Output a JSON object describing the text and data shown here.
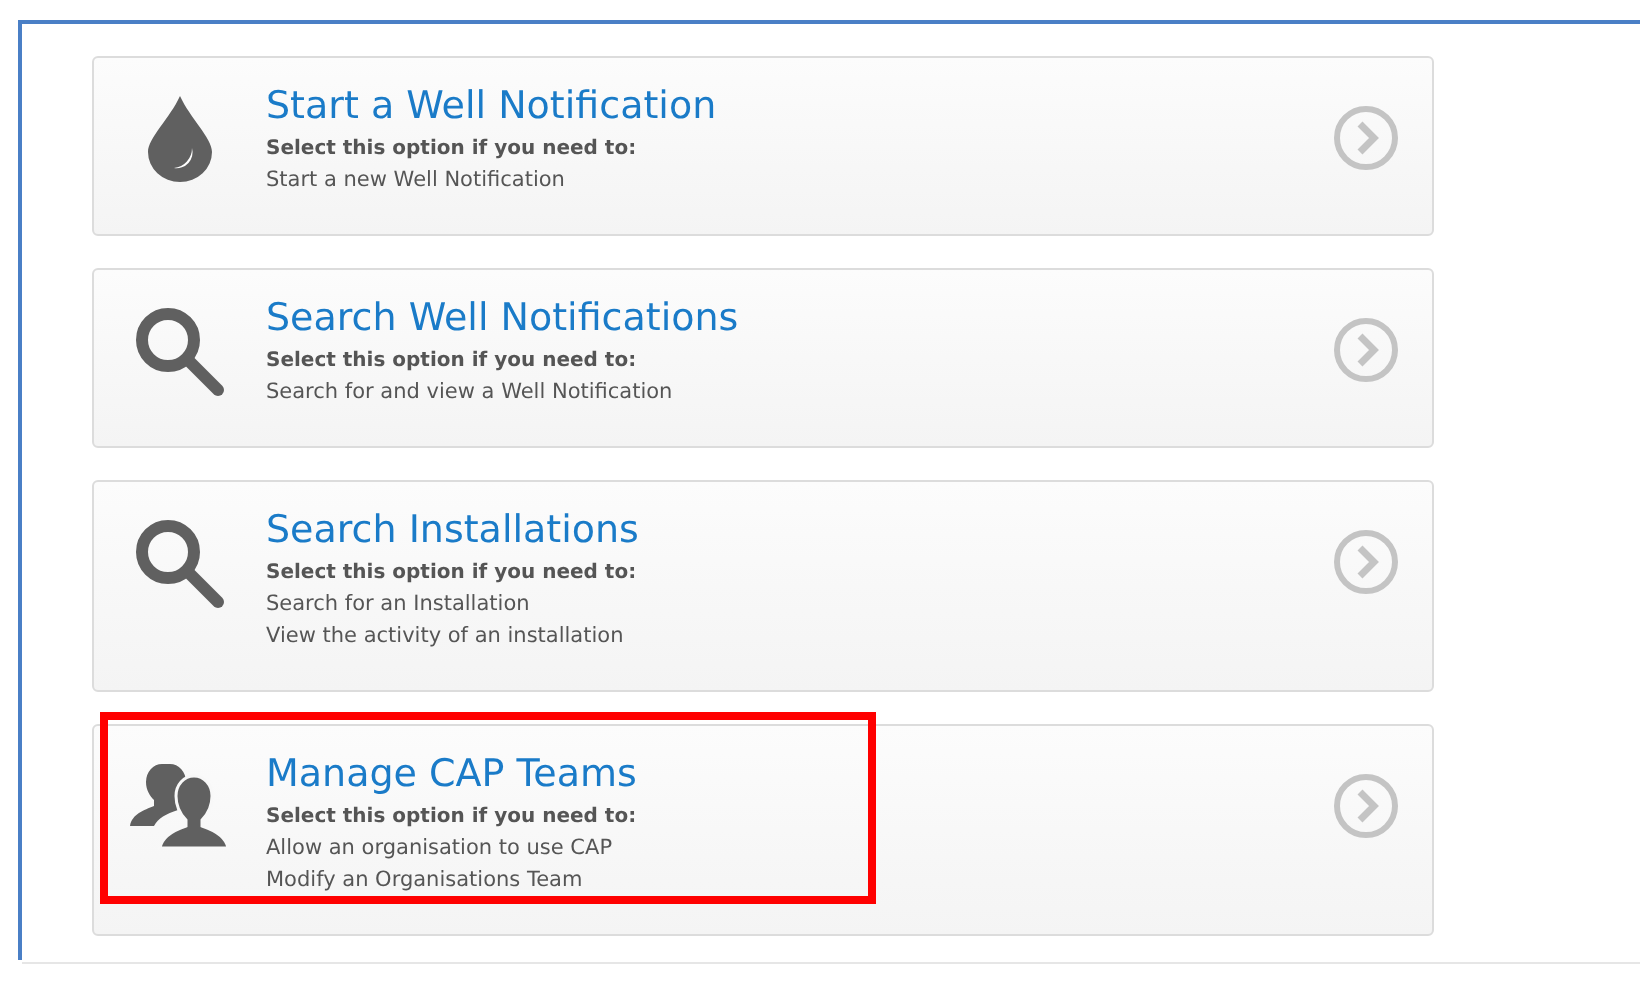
{
  "options": [
    {
      "kind": "drop",
      "title": "Start a Well Notification",
      "intro": "Select this option if you need to:",
      "lines": [
        "Start a new Well Notification"
      ],
      "highlighted": false
    },
    {
      "kind": "search",
      "title": "Search Well Notifications",
      "intro": "Select this option if you need to:",
      "lines": [
        "Search for and view a Well Notification"
      ],
      "highlighted": false
    },
    {
      "kind": "search",
      "title": "Search Installations",
      "intro": "Select this option if you need to:",
      "lines": [
        "Search for an Installation",
        "View the activity of an installation"
      ],
      "highlighted": false
    },
    {
      "kind": "people",
      "title": "Manage CAP Teams",
      "intro": "Select this option if you need to:",
      "lines": [
        "Allow an organisation to use CAP",
        "Modify an Organisations Team"
      ],
      "highlighted": true
    }
  ]
}
